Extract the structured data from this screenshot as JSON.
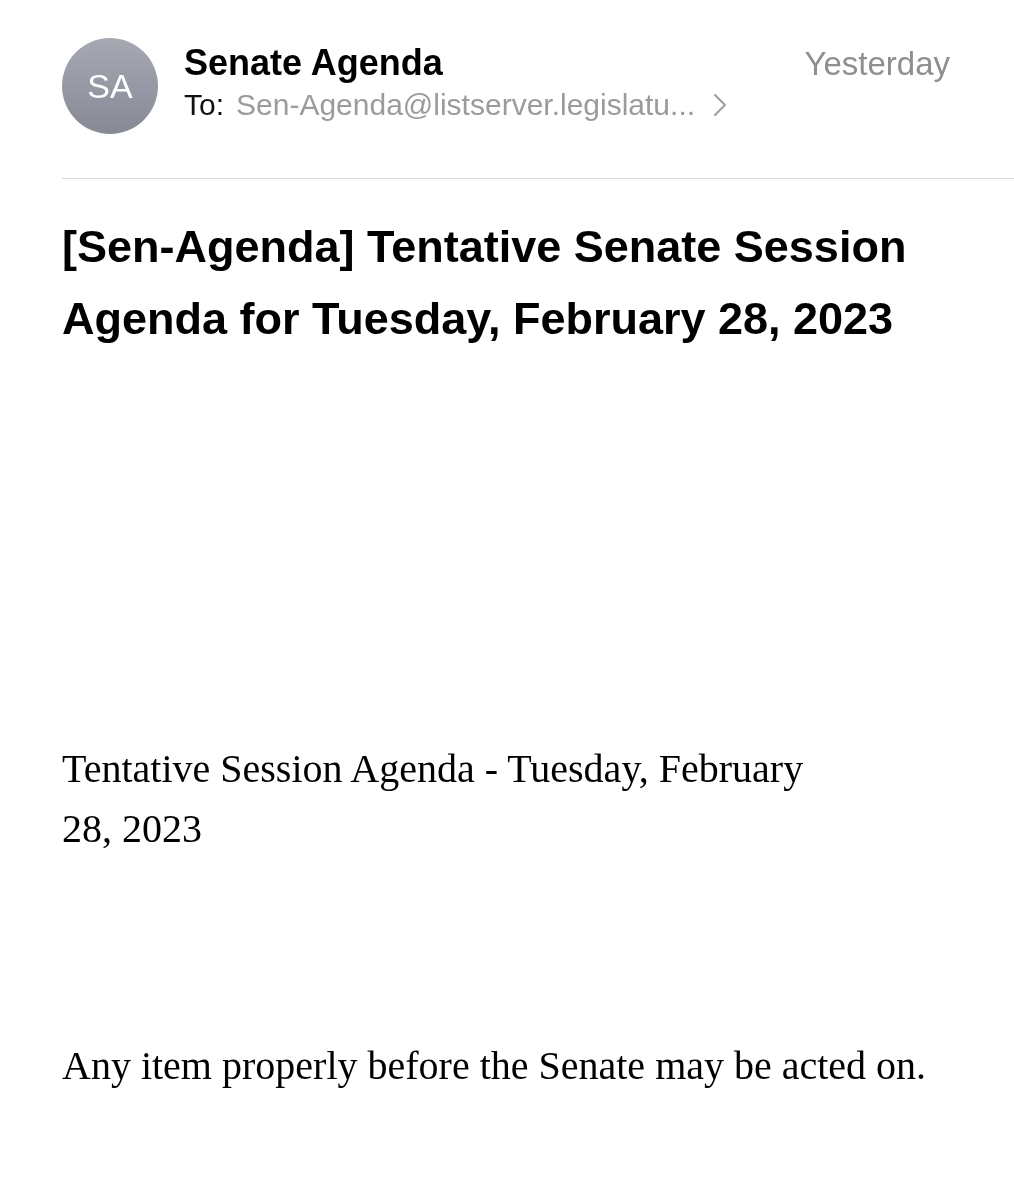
{
  "sender": {
    "initials": "SA",
    "name": "Senate Agenda",
    "date": "Yesterday",
    "to_label": "To:",
    "to_address": "Sen-Agenda@listserver.legislatu..."
  },
  "subject": "[Sen-Agenda] Tentative Senate Session Agenda for Tuesday, February 28, 2023",
  "body": [
    "Tentative Session Agenda - Tuesday, February 28, 2023",
    "Any item properly before the Senate may be acted on."
  ]
}
